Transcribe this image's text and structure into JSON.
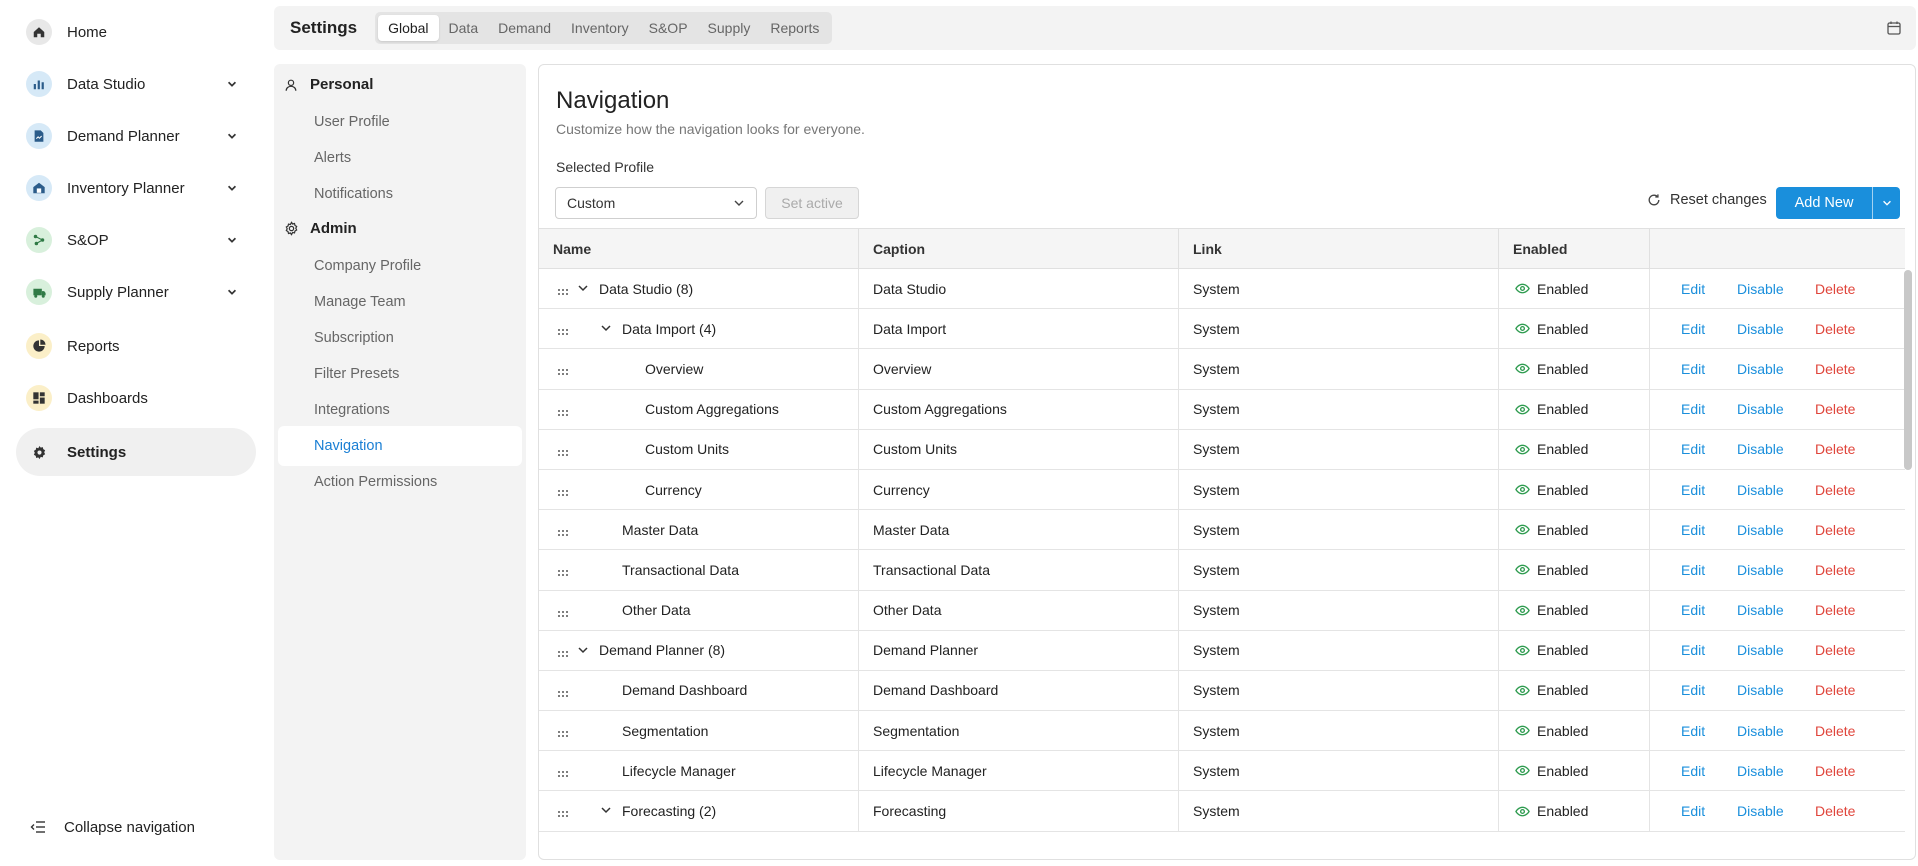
{
  "leftnav": {
    "items": [
      {
        "label": "Home",
        "icon": "home-icon",
        "color": "#e8e8e8",
        "has_chevron": false
      },
      {
        "label": "Data Studio",
        "icon": "data-studio-icon",
        "color": "#d6e9f7",
        "has_chevron": true
      },
      {
        "label": "Demand Planner",
        "icon": "demand-planner-icon",
        "color": "#d6e9f7",
        "has_chevron": true
      },
      {
        "label": "Inventory Planner",
        "icon": "inventory-planner-icon",
        "color": "#d6e9f7",
        "has_chevron": true
      },
      {
        "label": "S&OP",
        "icon": "sop-icon",
        "color": "#d8f0dc",
        "has_chevron": true
      },
      {
        "label": "Supply Planner",
        "icon": "supply-planner-icon",
        "color": "#d8f0dc",
        "has_chevron": true
      },
      {
        "label": "Reports",
        "icon": "reports-icon",
        "color": "#fbefc8",
        "has_chevron": false
      },
      {
        "label": "Dashboards",
        "icon": "dashboards-icon",
        "color": "#fbefc8",
        "has_chevron": false
      },
      {
        "label": "Settings",
        "icon": "gear-icon",
        "color": "#f0f0f0",
        "has_chevron": false,
        "active": true
      }
    ],
    "collapse_label": "Collapse navigation"
  },
  "topbar": {
    "title": "Settings",
    "tabs": [
      "Global",
      "Data",
      "Demand",
      "Inventory",
      "S&OP",
      "Supply",
      "Reports"
    ],
    "active_tab": "Global"
  },
  "settings_sidebar": {
    "personal": {
      "heading": "Personal",
      "links": [
        "User Profile",
        "Alerts",
        "Notifications"
      ]
    },
    "admin": {
      "heading": "Admin",
      "links": [
        "Company Profile",
        "Manage Team",
        "Subscription",
        "Filter Presets",
        "Integrations",
        "Navigation",
        "Action Permissions"
      ]
    },
    "active_link": "Navigation"
  },
  "main": {
    "title": "Navigation",
    "subtitle": "Customize how the navigation looks for everyone.",
    "profile_label": "Selected Profile",
    "profile_value": "Custom",
    "set_active_label": "Set active",
    "reset_label": "Reset changes",
    "add_new_label": "Add New",
    "colors": {
      "accent": "#1a8fdc",
      "danger": "#e0453b",
      "enabled": "#2e9b4f"
    }
  },
  "table": {
    "columns": [
      "Name",
      "Caption",
      "Link",
      "Enabled",
      ""
    ],
    "rows": [
      {
        "name": "Data Studio (8)",
        "caption": "Data Studio",
        "link": "System",
        "enabled": "Enabled",
        "level": 0,
        "expandable": true
      },
      {
        "name": "Data Import (4)",
        "caption": "Data Import",
        "link": "System",
        "enabled": "Enabled",
        "level": 1,
        "expandable": true
      },
      {
        "name": "Overview",
        "caption": "Overview",
        "link": "System",
        "enabled": "Enabled",
        "level": 2,
        "expandable": false
      },
      {
        "name": "Custom Aggregations",
        "caption": "Custom Aggregations",
        "link": "System",
        "enabled": "Enabled",
        "level": 2,
        "expandable": false
      },
      {
        "name": "Custom Units",
        "caption": "Custom Units",
        "link": "System",
        "enabled": "Enabled",
        "level": 2,
        "expandable": false
      },
      {
        "name": "Currency",
        "caption": "Currency",
        "link": "System",
        "enabled": "Enabled",
        "level": 2,
        "expandable": false
      },
      {
        "name": "Master Data",
        "caption": "Master Data",
        "link": "System",
        "enabled": "Enabled",
        "level": 1,
        "expandable": false
      },
      {
        "name": "Transactional Data",
        "caption": "Transactional Data",
        "link": "System",
        "enabled": "Enabled",
        "level": 1,
        "expandable": false
      },
      {
        "name": "Other Data",
        "caption": "Other Data",
        "link": "System",
        "enabled": "Enabled",
        "level": 1,
        "expandable": false
      },
      {
        "name": "Demand Planner (8)",
        "caption": "Demand Planner",
        "link": "System",
        "enabled": "Enabled",
        "level": 0,
        "expandable": true
      },
      {
        "name": "Demand Dashboard",
        "caption": "Demand Dashboard",
        "link": "System",
        "enabled": "Enabled",
        "level": 1,
        "expandable": false
      },
      {
        "name": "Segmentation",
        "caption": "Segmentation",
        "link": "System",
        "enabled": "Enabled",
        "level": 1,
        "expandable": false
      },
      {
        "name": "Lifecycle Manager",
        "caption": "Lifecycle Manager",
        "link": "System",
        "enabled": "Enabled",
        "level": 1,
        "expandable": false
      },
      {
        "name": "Forecasting (2)",
        "caption": "Forecasting",
        "link": "System",
        "enabled": "Enabled",
        "level": 1,
        "expandable": true
      }
    ],
    "actions": {
      "edit": "Edit",
      "disable": "Disable",
      "delete": "Delete"
    }
  }
}
